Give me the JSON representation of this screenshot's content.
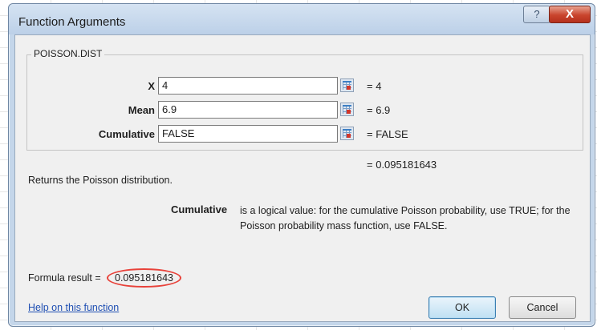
{
  "dialog": {
    "title": "Function Arguments",
    "help_glyph": "?",
    "close_glyph": "X"
  },
  "function_group": {
    "name": "POISSON.DIST",
    "args": [
      {
        "label": "X",
        "value": "4",
        "evaluated": "4"
      },
      {
        "label": "Mean",
        "value": "6.9",
        "evaluated": "6.9"
      },
      {
        "label": "Cumulative",
        "value": "FALSE",
        "evaluated": "FALSE"
      }
    ],
    "result_eq": "=",
    "result": "0.095181643"
  },
  "description": {
    "summary": "Returns the Poisson distribution.",
    "param_name": "Cumulative",
    "param_text": "is a logical value: for the cumulative Poisson probability, use TRUE; for the Poisson probability mass function, use FALSE."
  },
  "formula": {
    "label": "Formula result =",
    "value": "0.095181643"
  },
  "footer": {
    "help_link": "Help on this function",
    "ok_label": "OK",
    "cancel_label": "Cancel"
  },
  "colors": {
    "highlight_circle": "#e8423a",
    "link": "#1f4fb3",
    "close_button": "#c9442d"
  },
  "icons": [
    "help-icon",
    "close-icon",
    "range-select-icon"
  ]
}
